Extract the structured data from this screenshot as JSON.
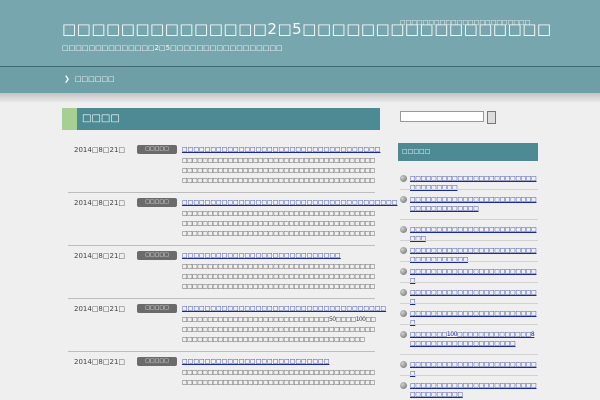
{
  "header": {
    "title": "□□□□□□□□□□□□□□2□5□□□□□□□□□□□□□□□□□",
    "description": "□□□□□□□□□□□□□□2□5□□□□□□□□□□□□□□□□□",
    "top_right_text": "□□□□□□□□□□□□□□□□□□□□□□□"
  },
  "nav": {
    "chevron": "❯",
    "items": [
      "□□□□□□"
    ]
  },
  "main": {
    "heading": "□□□□",
    "posts": [
      {
        "date": "2014□8□21□",
        "badge": "□□□□□",
        "title": "□□□□□□□□□□□□□□□□□□□□□□□□□□□□□□□□□□□",
        "body": "□□□□□□□□□□□□□□□□□□□□□□□□□□□□□□□□□□□□□□□□□□□□□□□□□□□□□□□□□□□□□□□□□□□□□□□□□□□□□□□□□□□□□□□□□□□□□□□□□□□□□□□□□□□□□□□□□□"
      },
      {
        "date": "2014□8□21□",
        "badge": "□□□□□",
        "title": "□□□□□□□□□□□□□□□□□□□□□□□□□□□□□□□□□□□□□□",
        "body": "□□□□□□□□□□□□□□□□□□□□□□□□□□□□□□□□□□□□□□□□□□□□□□□□□□□□□□□□□□□□□□□□□□□□□□□□□□□□□□□□□□□□□□□□□□□□□□□□□□□□□□□□□□□□□□□□□□"
      },
      {
        "date": "2014□8□21□",
        "badge": "□□□□□",
        "title": "□□□□□□□□□□□□□□□□□□□□□□□□□□□□",
        "body": "□□□□□□□□□□□□□□□□□□□□□□□□□□□□□□□□□□□□□□□□□□□□□□□□□□□□□□□□□□□□□□□□□□□□□□□□□□□□□□□□□□□□□□□□□□□□□□□□□□□□□□□□□□□□□□□□□□"
      },
      {
        "date": "2014□8□21□",
        "badge": "□□□□□",
        "title": "□□□□□□□□□□□□□□□□□□□□□□□□□□□□□□□□□□□□",
        "body": "□□□□□□□□□□□□□□□□□□□□□□□□□□□□□50□□□□100□□□□□□□□□□□□□□□□□□□□□□□□□□□□□□□□□□□□□□□□□□□□□□□□□□□□□□□□□□□□□□□□□□□□□□□□□□□□"
      },
      {
        "date": "2014□8□21□",
        "badge": "□□□□□",
        "title": "□□□□□□□□□□□□□□□□□□□□□□□□□□",
        "body": "□□□□□□□□□□□□□□□□□□□□□□□□□□□□□□□□□□□□□□□□□□□□□□□□□□□□□□□□□□□□□□□□□□□□□□□□□□□□"
      }
    ]
  },
  "sidebar": {
    "search": {
      "value": "",
      "button_label": ""
    },
    "heading": "□□□□□",
    "items": [
      "□□□□□□□□□□□□□□□□□□□□□□□□□□□□□□□□□",
      "□□□□□□□□□□□□□□□□□□□□□□□□□□□□□□□□□□□□□",
      "□□□□□□□□□□□□□□□□□□□□□□□□□□□",
      "□□□□□□□□□□□□□□□□□□□□□□□□□□□□□□□□□□□",
      "□□□□□□□□□□□□□□□□□□□□□□□□□",
      "□□□□□□□□□□□□□□□□□□□□□□□□□",
      "□□□□□□□□□□□□□□□□□□□□□□□□□",
      "□□□□□□□100□□□□□□□□□□□□□□8□□□□□□□□□□□□□□□□□□□□",
      "□□□□□□□□□□□□□□□□□□□□□□□□□",
      "□□□□□□□□□□□□□□□□□□□□□□□□□□□□□□□□□□"
    ]
  },
  "colors": {
    "header_bg": "#78a6ae",
    "nav_bg": "#6e9ea6",
    "heading_bg": "#4d8a93",
    "heading_accent": "#a5cf95",
    "link": "#1a2a99",
    "badge_bg": "#6b6b6b",
    "page_bg": "#efefef"
  }
}
